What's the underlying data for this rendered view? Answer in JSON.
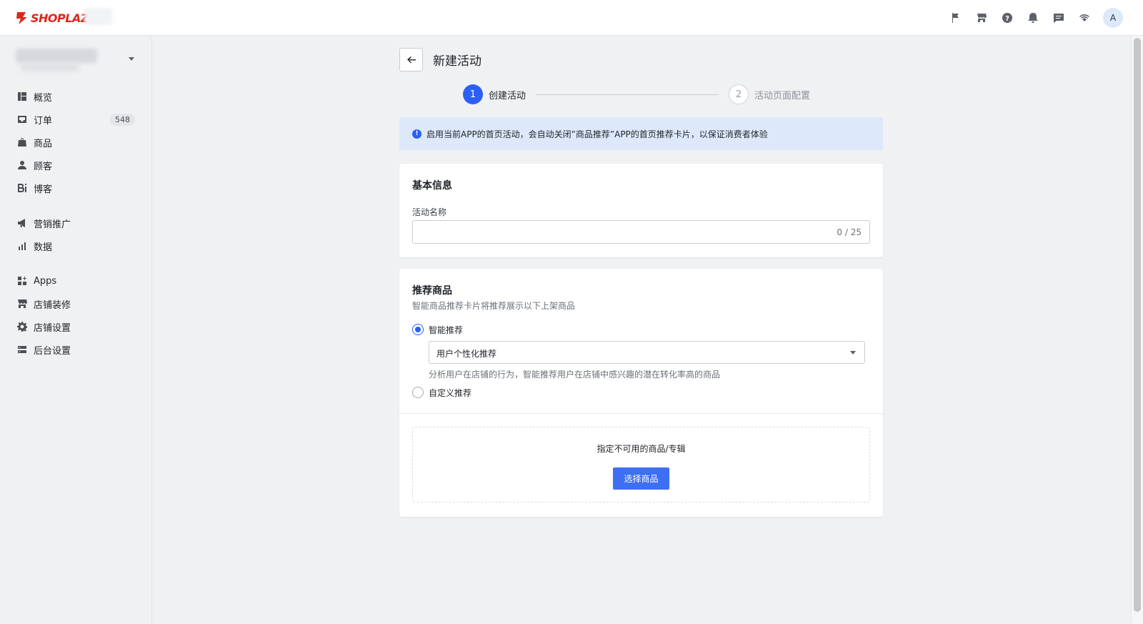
{
  "brand": {
    "name": "SHOPLAZZA",
    "color": "#e1251b"
  },
  "topbar": {
    "icons": [
      "flag-icon",
      "store-icon",
      "help-icon",
      "bell-icon",
      "message-icon",
      "wifi-icon"
    ],
    "avatar": "A"
  },
  "sidebar": {
    "items": [
      {
        "label": "概览",
        "icon": "dashboard-icon"
      },
      {
        "label": "订单",
        "icon": "inbox-icon",
        "badge": "548"
      },
      {
        "label": "商品",
        "icon": "bag-icon"
      },
      {
        "label": "顾客",
        "icon": "person-icon"
      },
      {
        "label": "博客",
        "icon": "blog-icon"
      },
      {
        "label": "营销推广",
        "icon": "megaphone-icon"
      },
      {
        "label": "数据",
        "icon": "bar-chart-icon"
      },
      {
        "label": "Apps",
        "icon": "apps-icon"
      },
      {
        "label": "店铺装修",
        "icon": "store-icon"
      },
      {
        "label": "店铺设置",
        "icon": "gear-icon"
      },
      {
        "label": "后台设置",
        "icon": "server-icon"
      }
    ]
  },
  "page": {
    "title": "新建活动",
    "steps": [
      {
        "number": "1",
        "label": "创建活动",
        "state": "active"
      },
      {
        "number": "2",
        "label": "活动页面配置",
        "state": "inactive"
      }
    ],
    "alert": "启用当前APP的首页活动，会自动关闭”商品推荐”APP的首页推荐卡片，以保证消费者体验"
  },
  "basic_info": {
    "title": "基本信息",
    "name_label": "活动名称",
    "name_value": "",
    "counter": "0 / 25"
  },
  "recommend": {
    "title": "推荐商品",
    "description": "智能商品推荐卡片将推荐展示以下上架商品",
    "smart_label": "智能推荐",
    "select_value": "用户个性化推荐",
    "select_hint": "分析用户在店铺的行为，智能推荐用户在店铺中感兴趣的潜在转化率高的商品",
    "custom_label": "自定义推荐",
    "exclude_title": "指定不可用的商品/专辑",
    "select_button": "选择商品"
  },
  "colors": {
    "primary": "#2b5ff5",
    "alert_bg": "#dde9fb"
  }
}
